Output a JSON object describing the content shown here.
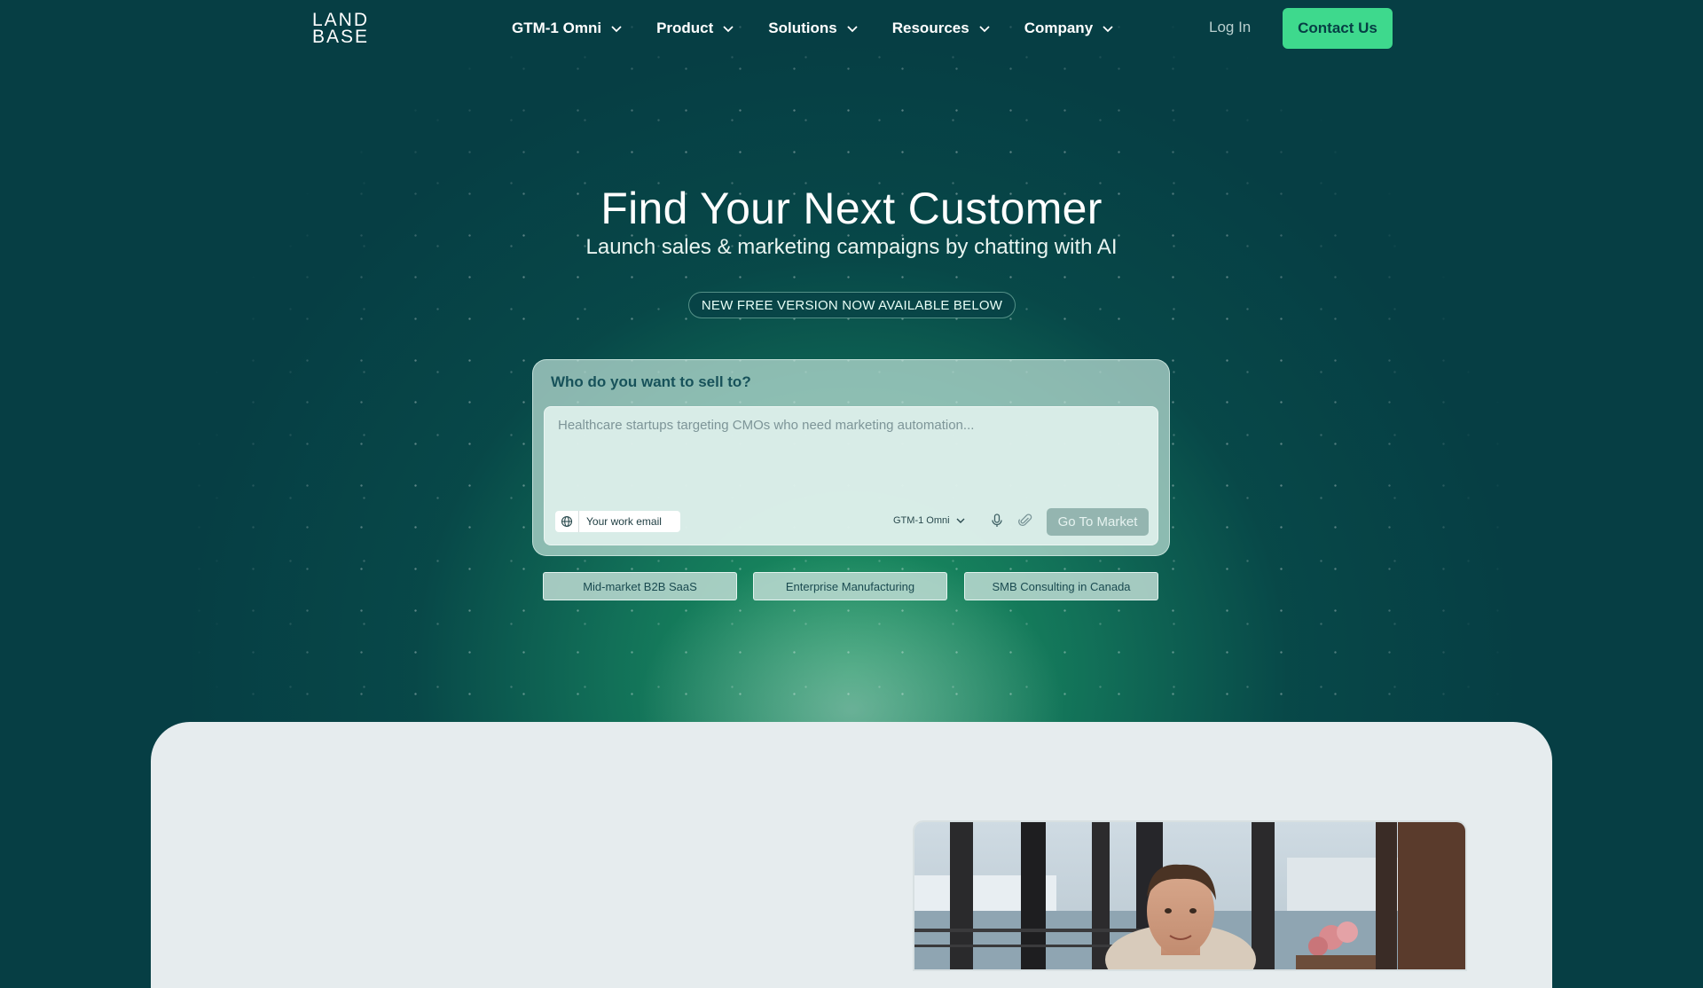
{
  "nav": {
    "logo_line1": "LAND",
    "logo_line2": "BASE",
    "items": [
      {
        "label": "GTM-1 Omni"
      },
      {
        "label": "Product"
      },
      {
        "label": "Solutions"
      },
      {
        "label": "Resources"
      },
      {
        "label": "Company"
      }
    ],
    "login_label": "Log In",
    "contact_label": "Contact Us"
  },
  "hero": {
    "title": "Find Your Next Customer",
    "subtitle": "Launch sales & marketing campaigns by chatting with AI",
    "badge": "NEW FREE VERSION NOW AVAILABLE BELOW"
  },
  "chat": {
    "label": "Who do you want to sell to?",
    "placeholder": "Healthcare startups targeting CMOs who need marketing automation...",
    "email_label": "Your work email",
    "model_label": "GTM-1 Omni",
    "submit_label": "Go To Market"
  },
  "suggestions": [
    {
      "label": "Mid-market B2B SaaS"
    },
    {
      "label": "Enterprise Manufacturing"
    },
    {
      "label": "SMB Consulting in Canada"
    }
  ],
  "colors": {
    "background": "#063e44",
    "accent": "#3ed98d",
    "glow": "#1ea064"
  },
  "icons": {
    "chevron": "chevron-down-icon",
    "globe": "globe-icon",
    "mic": "microphone-icon",
    "attach": "paperclip-icon"
  }
}
